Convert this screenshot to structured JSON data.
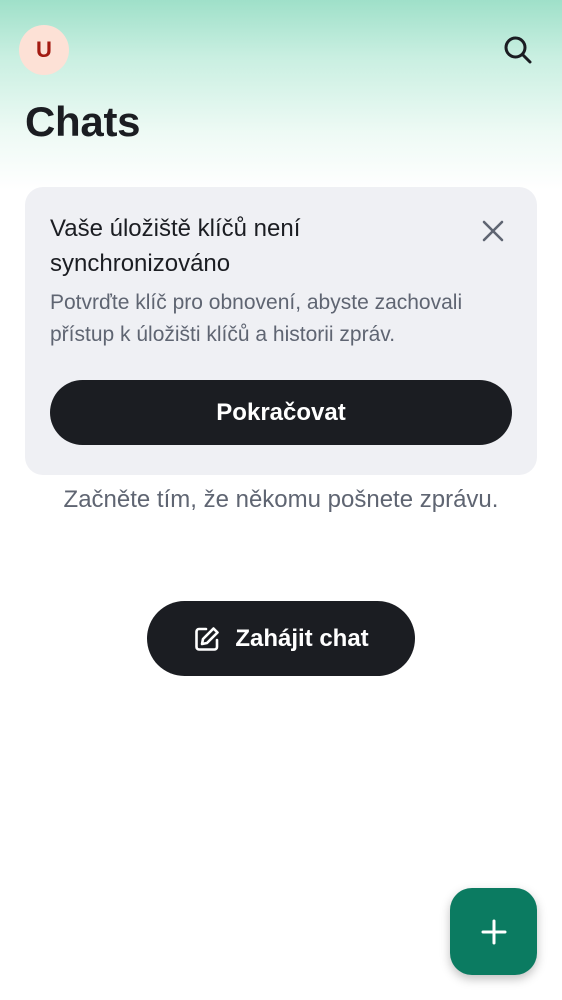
{
  "header": {
    "avatar_initial": "U",
    "title": "Chats",
    "search_icon": "search-icon"
  },
  "banner": {
    "title": "Vaše úložiště klíčů není synchronizováno",
    "description": "Potvrďte klíč pro obnovení, abyste zachovali přístup k úložišti klíčů a historii zpráv.",
    "button_label": "Pokračovat",
    "close_icon": "close-icon"
  },
  "empty_state": {
    "message": "Začněte tím, že někomu pošnete zprávu.",
    "start_chat_label": "Zahájit chat",
    "start_chat_icon": "edit-icon"
  },
  "fab": {
    "icon": "plus-icon",
    "color": "#0b7b61"
  },
  "colors": {
    "primary_dark": "#1b1d22",
    "secondary_text": "#5f6572",
    "card_bg": "#eff0f4",
    "avatar_bg": "#fde1d6",
    "avatar_text": "#a31b12"
  }
}
